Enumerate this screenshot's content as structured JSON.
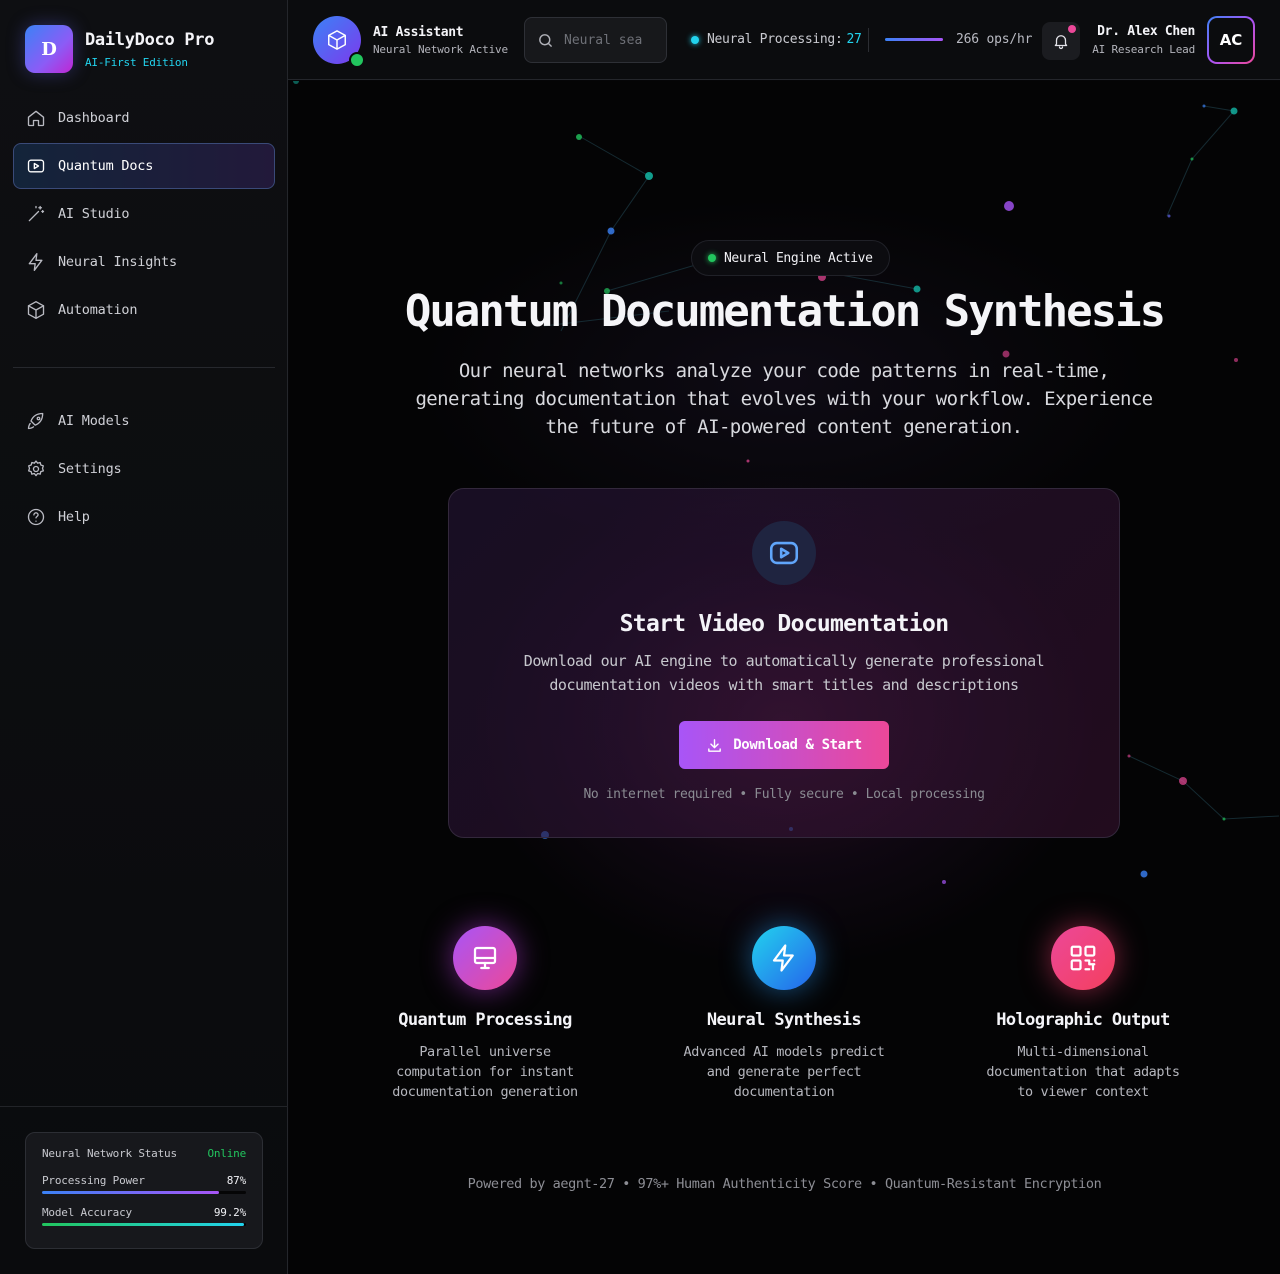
{
  "brand": {
    "logo_letter": "D",
    "name": "DailyDoco Pro",
    "edition": "AI-First Edition"
  },
  "sidebar": {
    "primary": [
      {
        "label": "Dashboard",
        "icon": "home-icon"
      },
      {
        "label": "Quantum Docs",
        "icon": "play-icon",
        "active": true
      },
      {
        "label": "AI Studio",
        "icon": "magic-wand-icon"
      },
      {
        "label": "Neural Insights",
        "icon": "lightning-icon"
      },
      {
        "label": "Automation",
        "icon": "cube-icon"
      }
    ],
    "secondary": [
      {
        "label": "AI Models",
        "icon": "rocket-icon"
      },
      {
        "label": "Settings",
        "icon": "gear-icon"
      },
      {
        "label": "Help",
        "icon": "help-circle-icon"
      }
    ],
    "status": {
      "title": "Neural Network Status",
      "state": "Online",
      "processing_label": "Processing Power",
      "processing_value": "87%",
      "processing_fraction": 0.87,
      "accuracy_label": "Model Accuracy",
      "accuracy_value": "99.2%",
      "accuracy_fraction": 0.992
    }
  },
  "header": {
    "assistant_title": "AI Assistant",
    "assistant_sub": "Neural Network Active",
    "search_placeholder": "Neural sea",
    "processing_label": "Neural Processing:",
    "processing_value": "27",
    "ops_text": "266 ops/hr",
    "user_name": "Dr. Alex Chen",
    "user_role": "AI Research Lead",
    "user_initials": "AC"
  },
  "hero": {
    "badge": "Neural Engine Active",
    "title": "Quantum Documentation Synthesis",
    "description": "Our neural networks analyze your code patterns in real-time, generating documentation that evolves with your workflow. Experience the future of AI-powered content generation."
  },
  "card": {
    "title": "Start Video Documentation",
    "description": "Download our AI engine to automatically generate professional documentation videos with smart titles and descriptions",
    "button": "Download & Start",
    "note": "No internet required • Fully secure • Local processing"
  },
  "features": [
    {
      "title": "Quantum Processing",
      "description": "Parallel universe computation for instant documentation generation",
      "icon": "monitor-icon"
    },
    {
      "title": "Neural Synthesis",
      "description": "Advanced AI models predict and generate perfect documentation",
      "icon": "lightning-icon"
    },
    {
      "title": "Holographic Output",
      "description": "Multi-dimensional documentation that adapts to viewer context",
      "icon": "qr-code-icon"
    }
  ],
  "footer": "Powered by aegnt-27 • 97%+ Human Authenticity Score • Quantum-Resistant Encryption",
  "colors": {
    "accent_cyan": "#22d3ee",
    "accent_purple": "#a855f7",
    "accent_pink": "#ec4899",
    "online_green": "#22c55e"
  }
}
